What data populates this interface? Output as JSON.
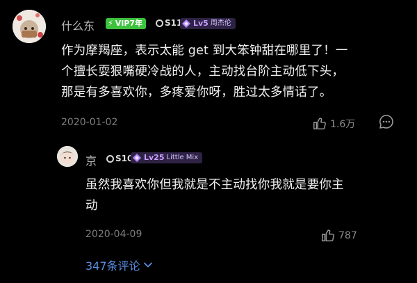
{
  "comment": {
    "username": "什么东",
    "vip_badge": "VIP7年",
    "silver_badge": "S11",
    "level": "Lv5",
    "level_tag": "周杰伦",
    "text_lines": [
      "作为摩羯座，表示太能 get 到大笨钟甜在哪里了！一",
      "个擅长耍狠嘴硬冷战的人，主动找台阶主动低下头，",
      "那是有多喜欢你，多疼爱你呀，胜过太多情话了。"
    ],
    "date": "2020-01-02",
    "likes": "1.6万"
  },
  "reply": {
    "username": "京",
    "silver_badge": "S10",
    "level": "Lv25",
    "level_tag": "Little Mix",
    "text_lines": [
      "虽然我喜欢你但我就是不主动找你我就是要你主",
      "动"
    ],
    "date": "2020-04-09",
    "likes": "787"
  },
  "more_replies_label": "347条评论",
  "colors": {
    "background": "#000000",
    "vip_green": "#3ec23e",
    "level_purple": "#c69dff",
    "link_blue": "#5b8fe6"
  }
}
